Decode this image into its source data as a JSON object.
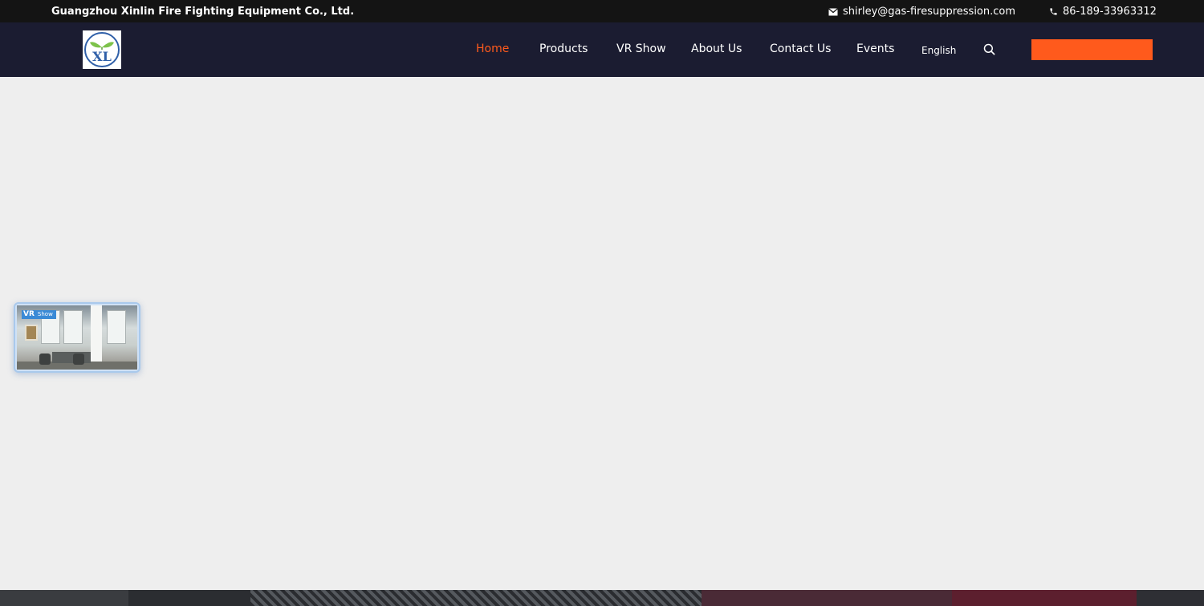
{
  "topbar": {
    "company": "Guangzhou Xinlin Fire Fighting Equipment Co., Ltd.",
    "email": "shirley@gas-firesuppression.com",
    "phone": "86-189-33963312"
  },
  "nav": {
    "logo_text": "XL",
    "items": [
      {
        "label": "Home",
        "active": true
      },
      {
        "label": "Products"
      },
      {
        "label": "VR Show"
      },
      {
        "label": "About Us"
      },
      {
        "label": "Contact Us"
      },
      {
        "label": "Events"
      }
    ],
    "language": "English",
    "quote_button_label": ""
  },
  "vr_widget": {
    "badge_vr": "VR",
    "badge_show": "Show"
  },
  "colors": {
    "accent": "#ff5a1c",
    "nav_bg": "#1b1c31",
    "topbar_bg": "#141414",
    "hero_bg": "#eeeeee"
  }
}
